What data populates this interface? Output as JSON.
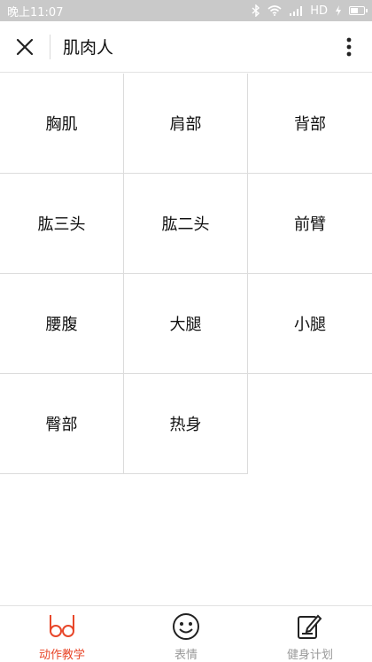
{
  "status_bar": {
    "time": "晚上11:07",
    "network": "HD"
  },
  "header": {
    "title": "肌肉人"
  },
  "grid": {
    "items": [
      {
        "label": "胸肌"
      },
      {
        "label": "肩部"
      },
      {
        "label": "背部"
      },
      {
        "label": "肱三头"
      },
      {
        "label": "肱二头"
      },
      {
        "label": "前臂"
      },
      {
        "label": "腰腹"
      },
      {
        "label": "大腿"
      },
      {
        "label": "小腿"
      },
      {
        "label": "臀部"
      },
      {
        "label": "热身"
      }
    ]
  },
  "tabbar": {
    "tabs": [
      {
        "label": "动作教学",
        "icon": "glasses-icon",
        "active": true
      },
      {
        "label": "表情",
        "icon": "smiley-icon",
        "active": false
      },
      {
        "label": "健身计划",
        "icon": "edit-note-icon",
        "active": false
      }
    ]
  },
  "colors": {
    "accent": "#e8472a",
    "status_bar_bg": "#c9c9c9",
    "divider": "#dcdcdc"
  }
}
